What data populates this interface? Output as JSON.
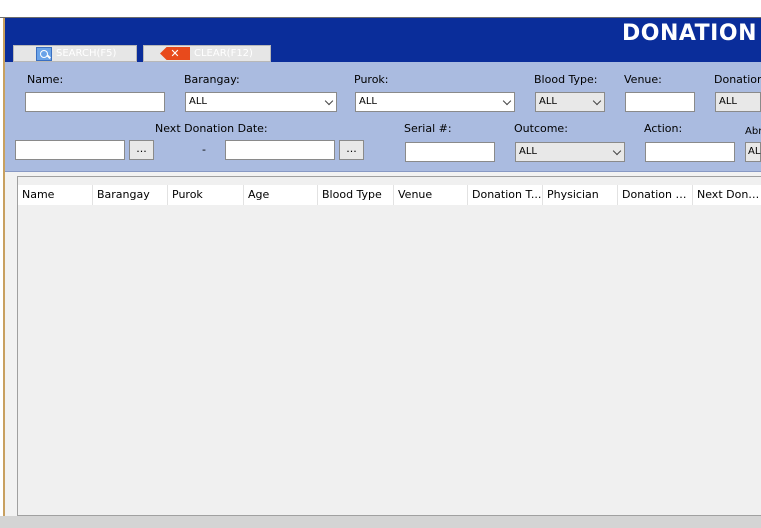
{
  "header": {
    "title": "DONATION",
    "search_label": "SEARCH(F5)",
    "clear_label": "CLEAR(F12)",
    "search_icon": "search-icon",
    "clear_icon": "clear-x-icon"
  },
  "filters": {
    "name_label": "Name:",
    "barangay_label": "Barangay:",
    "barangay_value": "ALL",
    "purok_label": "Purok:",
    "purok_value": "ALL",
    "blood_type_label": "Blood Type:",
    "blood_type_value": "ALL",
    "venue_label": "Venue:",
    "donation_type_label": "Donation T",
    "donation_type_value": "ALL",
    "next_donation_date_label": "Next Donation Date:",
    "date_picker_label": "...",
    "date_separator": "-",
    "serial_label": "Serial #:",
    "outcome_label": "Outcome:",
    "outcome_value": "ALL",
    "action_label": "Action:",
    "abroad_label": "Abr",
    "abroad_value": "AL"
  },
  "grid": {
    "columns": [
      "Name",
      "Barangay",
      "Purok",
      "Age",
      "Blood Type",
      "Venue",
      "Donation T...",
      "Physician",
      "Donation D...",
      "Next Dona..."
    ]
  },
  "colors": {
    "header_blue": "#0a2d9a",
    "filter_panel": "#aabbe0",
    "clear_icon_red": "#e84a1c"
  }
}
